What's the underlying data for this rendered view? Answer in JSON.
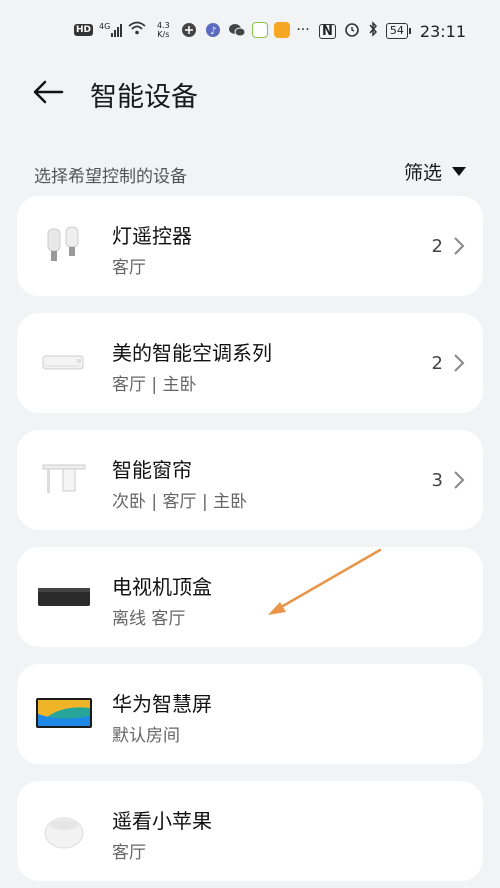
{
  "status_bar": {
    "hd": "HD",
    "net_type": "4G",
    "speed_value": "4.3",
    "speed_unit": "K/s",
    "more": "···",
    "battery": "54",
    "time": "23:11"
  },
  "header": {
    "title": "智能设备"
  },
  "subheader": {
    "label": "选择希望控制的设备",
    "filter_label": "筛选"
  },
  "devices": [
    {
      "name": "灯遥控器",
      "room": "客厅",
      "count": "2",
      "icon": "bulb-icon"
    },
    {
      "name": "美的智能空调系列",
      "room": "客厅 | 主卧",
      "count": "2",
      "icon": "air-conditioner-icon"
    },
    {
      "name": "智能窗帘",
      "room": "次卧 | 客厅 | 主卧",
      "count": "3",
      "icon": "curtain-icon"
    },
    {
      "name": "电视机顶盒",
      "room": "离线 客厅",
      "count": "",
      "icon": "set-top-box-icon"
    },
    {
      "name": "华为智慧屏",
      "room": "默认房间",
      "count": "",
      "icon": "smart-screen-icon"
    },
    {
      "name": "遥看小苹果",
      "room": "客厅",
      "count": "",
      "icon": "camera-icon"
    }
  ],
  "colors": {
    "background": "#f1f3f5",
    "card": "#ffffff",
    "annotation_arrow": "#e8954a"
  }
}
